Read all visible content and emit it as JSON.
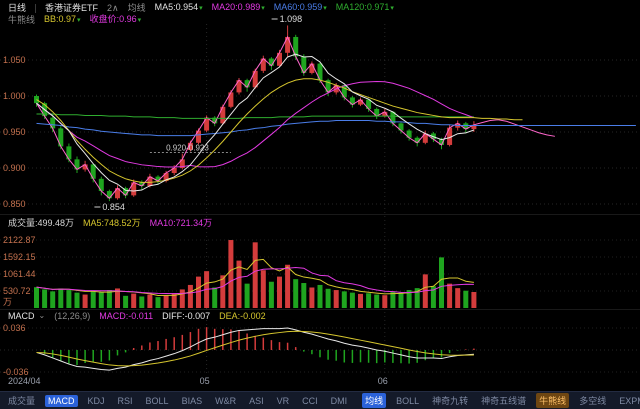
{
  "icons": {
    "down_arrow": "▾",
    "caret_down": "⌄"
  },
  "header": {
    "period": "日线",
    "symbol": "香港证券ETF",
    "layout_toggle": "2∧",
    "ma_label": "均线",
    "ma_items": [
      {
        "label": "MA5:0.954",
        "color": "#e2e2e2",
        "arrow": true
      },
      {
        "label": "MA20:0.989",
        "color": "#e23ae2",
        "arrow": true
      },
      {
        "label": "MA60:0.959",
        "color": "#4a7de8",
        "arrow": true
      },
      {
        "label": "MA120:0.971",
        "color": "#2fae2f",
        "arrow": true
      }
    ],
    "bb_label": "牛熊线",
    "bb_items": [
      {
        "label": "BB:0.97",
        "color": "#d6c62e",
        "arrow": true
      },
      {
        "label": "收盘价:0.96",
        "color": "#e23ae2",
        "arrow": true
      }
    ]
  },
  "volume_header": {
    "items": [
      {
        "label": "成交量:499.48万",
        "color": "#d8d8d8",
        "arrow": false
      },
      {
        "label": "MA5:748.52万",
        "color": "#d6c62e",
        "arrow": false
      },
      {
        "label": "MA10:721.34万",
        "color": "#e23ae2",
        "arrow": false
      }
    ]
  },
  "macd_header": {
    "title": "MACD",
    "params": "(12,26,9)",
    "items": [
      {
        "label": "MACD:-0.011",
        "color": "#e23ae2",
        "arrow": false
      },
      {
        "label": "DIFF:-0.007",
        "color": "#e8e8e8",
        "arrow": false
      },
      {
        "label": "DEA:-0.002",
        "color": "#d6c62e",
        "arrow": false
      }
    ]
  },
  "axes": {
    "price_labels": [
      "1.050",
      "1.000",
      "0.950",
      "0.900",
      "0.850"
    ],
    "volume_labels": [
      "2122.87",
      "1592.15",
      "1061.44",
      "530.72",
      "万"
    ],
    "macd_labels": [
      "0.036",
      "-0.036"
    ],
    "x_labels": [
      "2024/04",
      "05",
      "06"
    ]
  },
  "annotations": {
    "high": "1.098",
    "gap": "0.920-0.923",
    "low": "0.854"
  },
  "tabbar": {
    "left": [
      "成交量",
      "MACD",
      "KDJ",
      "RSI",
      "BOLL",
      "BIAS",
      "W&R",
      "ASI",
      "VR",
      "CCI",
      "DMI"
    ],
    "right": [
      "均线",
      "BOLL",
      "神奇九转",
      "神奇五线谱",
      "牛熊线",
      "多空线",
      "EXPMA"
    ],
    "selected_left": "MACD",
    "selected_right_blue": "均线",
    "selected_right_orange": "牛熊线"
  },
  "chart_data": {
    "type": "candlestick",
    "title": "香港证券ETF 日线",
    "colors": {
      "up": "#d43c3c",
      "down": "#1fa51f"
    },
    "price_axis": {
      "min": 0.84,
      "max": 1.11,
      "gridlines": [
        1.05,
        1.0,
        0.95,
        0.9,
        0.85
      ]
    },
    "volume_axis": {
      "gridlines": [
        2122.87,
        1592.15,
        1061.44,
        530.72
      ],
      "unit": "万"
    },
    "x_axis": {
      "tick_indices": [
        21,
        43
      ]
    },
    "ohlc": [
      [
        1.0,
        1.002,
        0.985,
        0.99
      ],
      [
        0.99,
        0.992,
        0.968,
        0.972
      ],
      [
        0.97,
        0.975,
        0.95,
        0.955
      ],
      [
        0.955,
        0.958,
        0.926,
        0.93
      ],
      [
        0.93,
        0.934,
        0.908,
        0.912
      ],
      [
        0.912,
        0.916,
        0.893,
        0.898
      ],
      [
        0.898,
        0.91,
        0.895,
        0.905
      ],
      [
        0.905,
        0.906,
        0.88,
        0.885
      ],
      [
        0.885,
        0.888,
        0.862,
        0.868
      ],
      [
        0.868,
        0.87,
        0.854,
        0.858
      ],
      [
        0.858,
        0.876,
        0.856,
        0.872
      ],
      [
        0.872,
        0.874,
        0.858,
        0.862
      ],
      [
        0.862,
        0.884,
        0.86,
        0.88
      ],
      [
        0.88,
        0.883,
        0.87,
        0.875
      ],
      [
        0.875,
        0.892,
        0.873,
        0.888
      ],
      [
        0.888,
        0.89,
        0.878,
        0.882
      ],
      [
        0.882,
        0.896,
        0.88,
        0.893
      ],
      [
        0.893,
        0.904,
        0.89,
        0.9
      ],
      [
        0.9,
        0.92,
        0.898,
        0.912
      ],
      [
        0.925,
        0.938,
        0.923,
        0.935
      ],
      [
        0.935,
        0.955,
        0.933,
        0.952
      ],
      [
        0.952,
        0.973,
        0.95,
        0.97
      ],
      [
        0.97,
        0.972,
        0.958,
        0.962
      ],
      [
        0.962,
        0.988,
        0.96,
        0.985
      ],
      [
        0.985,
        1.008,
        0.983,
        1.005
      ],
      [
        1.005,
        1.025,
        1.002,
        1.022
      ],
      [
        1.022,
        1.024,
        1.006,
        1.012
      ],
      [
        1.012,
        1.038,
        1.01,
        1.035
      ],
      [
        1.035,
        1.056,
        1.032,
        1.052
      ],
      [
        1.052,
        1.054,
        1.036,
        1.042
      ],
      [
        1.042,
        1.064,
        1.04,
        1.06
      ],
      [
        1.06,
        1.098,
        1.055,
        1.082
      ],
      [
        1.082,
        1.085,
        1.05,
        1.055
      ],
      [
        1.055,
        1.058,
        1.028,
        1.032
      ],
      [
        1.032,
        1.048,
        1.03,
        1.045
      ],
      [
        1.045,
        1.047,
        1.018,
        1.022
      ],
      [
        1.022,
        1.024,
        1.0,
        1.005
      ],
      [
        1.005,
        1.018,
        1.002,
        1.015
      ],
      [
        1.015,
        1.016,
        0.994,
        0.998
      ],
      [
        0.998,
        1.0,
        0.984,
        0.988
      ],
      [
        0.988,
        0.998,
        0.986,
        0.995
      ],
      [
        0.995,
        0.996,
        0.978,
        0.982
      ],
      [
        0.982,
        0.984,
        0.968,
        0.972
      ],
      [
        0.972,
        0.982,
        0.97,
        0.978
      ],
      [
        0.978,
        0.979,
        0.958,
        0.962
      ],
      [
        0.962,
        0.964,
        0.948,
        0.952
      ],
      [
        0.952,
        0.954,
        0.938,
        0.942
      ],
      [
        0.942,
        0.944,
        0.93,
        0.935
      ],
      [
        0.935,
        0.952,
        0.933,
        0.948
      ],
      [
        0.948,
        0.95,
        0.936,
        0.94
      ],
      [
        0.94,
        0.942,
        0.926,
        0.932
      ],
      [
        0.932,
        0.96,
        0.93,
        0.956
      ],
      [
        0.956,
        0.966,
        0.952,
        0.962
      ],
      [
        0.962,
        0.964,
        0.948,
        0.954
      ],
      [
        0.954,
        0.965,
        0.95,
        0.96
      ]
    ],
    "volumes": [
      650,
      580,
      520,
      610,
      560,
      480,
      420,
      530,
      490,
      560,
      610,
      380,
      450,
      360,
      420,
      340,
      400,
      460,
      580,
      720,
      980,
      1150,
      640,
      1020,
      2122,
      1480,
      760,
      2050,
      1180,
      820,
      980,
      1350,
      900,
      780,
      640,
      720,
      600,
      560,
      520,
      480,
      440,
      460,
      420,
      400,
      520,
      480,
      560,
      620,
      1050,
      680,
      1580,
      760,
      620,
      540,
      499.48
    ],
    "overlays": {
      "colors": {
        "ma5": "#e8e8e8",
        "ma20": "#e23ae2",
        "ma60": "#4a7de8",
        "ma120": "#2fae2f",
        "bb": "#d6c62e",
        "close_line": "#ff66cc",
        "vol_ma5": "#d6c62e",
        "vol_ma10": "#e23ae2",
        "diff": "#e8e8e8",
        "dea": "#d6c62e"
      },
      "ma60": [
        0.962,
        0.961,
        0.96,
        0.959,
        0.957,
        0.956,
        0.954,
        0.953,
        0.951,
        0.95,
        0.949,
        0.948,
        0.947,
        0.946,
        0.946,
        0.945,
        0.945,
        0.945,
        0.945,
        0.945,
        0.946,
        0.947,
        0.948,
        0.949,
        0.95,
        0.952,
        0.953,
        0.955,
        0.956,
        0.958,
        0.959,
        0.961,
        0.962,
        0.963,
        0.964,
        0.965,
        0.965,
        0.966,
        0.966,
        0.966,
        0.966,
        0.966,
        0.965,
        0.965,
        0.964,
        0.964,
        0.963,
        0.962,
        0.962,
        0.961,
        0.96,
        0.96,
        0.959,
        0.959,
        0.959
      ],
      "ma60_projection": [
        0.959,
        0.959,
        0.959,
        0.959,
        0.959,
        0.959,
        0.959,
        0.959,
        0.959,
        0.959,
        0.959,
        0.959,
        0.959,
        0.959,
        0.959,
        0.959,
        0.959,
        0.959,
        0.959,
        0.959
      ],
      "ma120": [
        0.975,
        0.975,
        0.975,
        0.974,
        0.974,
        0.974,
        0.973,
        0.973,
        0.973,
        0.972,
        0.972,
        0.972,
        0.971,
        0.971,
        0.971,
        0.97,
        0.97,
        0.97,
        0.969,
        0.969,
        0.969,
        0.969,
        0.969,
        0.969,
        0.969,
        0.969,
        0.97,
        0.97,
        0.97,
        0.97,
        0.971,
        0.971,
        0.971,
        0.971,
        0.972,
        0.972,
        0.972,
        0.972,
        0.972,
        0.972,
        0.972,
        0.972,
        0.972,
        0.972,
        0.972,
        0.971,
        0.971,
        0.971,
        0.971,
        0.971,
        0.971,
        0.971,
        0.971,
        0.971,
        0.971
      ],
      "bb": [
        0.995,
        0.988,
        0.978,
        0.966,
        0.952,
        0.938,
        0.926,
        0.915,
        0.905,
        0.896,
        0.89,
        0.885,
        0.882,
        0.88,
        0.88,
        0.881,
        0.883,
        0.886,
        0.89,
        0.896,
        0.904,
        0.914,
        0.925,
        0.937,
        0.95,
        0.963,
        0.975,
        0.986,
        0.996,
        1.005,
        1.012,
        1.018,
        1.022,
        1.024,
        1.024,
        1.022,
        1.019,
        1.015,
        1.011,
        1.006,
        1.002,
        0.998,
        0.994,
        0.99,
        0.986,
        0.983,
        0.98,
        0.977,
        0.975,
        0.973,
        0.971,
        0.97,
        0.97,
        0.97,
        0.97
      ],
      "bb_projection": [
        0.969,
        0.969,
        0.968,
        0.968,
        0.967,
        0.967
      ],
      "close_projection": [
        0.963,
        0.966,
        0.967,
        0.965,
        0.961,
        0.957,
        0.953,
        0.949,
        0.946,
        0.944
      ]
    },
    "macd": {
      "axis": [
        0.036,
        -0.036
      ],
      "diff": [
        -0.004,
        -0.008,
        -0.013,
        -0.018,
        -0.023,
        -0.027,
        -0.028,
        -0.03,
        -0.032,
        -0.033,
        -0.03,
        -0.028,
        -0.024,
        -0.021,
        -0.017,
        -0.014,
        -0.01,
        -0.006,
        -0.001,
        0.005,
        0.012,
        0.018,
        0.021,
        0.025,
        0.029,
        0.032,
        0.033,
        0.034,
        0.035,
        0.035,
        0.035,
        0.036,
        0.033,
        0.029,
        0.026,
        0.022,
        0.018,
        0.015,
        0.011,
        0.008,
        0.006,
        0.003,
        0.0,
        -0.002,
        -0.005,
        -0.008,
        -0.011,
        -0.013,
        -0.013,
        -0.013,
        -0.014,
        -0.011,
        -0.009,
        -0.008,
        -0.007
      ]
    },
    "annotations": {
      "high": {
        "index": 31,
        "value": 1.098
      },
      "low": {
        "index": 9,
        "value": 0.854
      },
      "gap": {
        "index": 18,
        "price": 0.9215
      }
    }
  }
}
